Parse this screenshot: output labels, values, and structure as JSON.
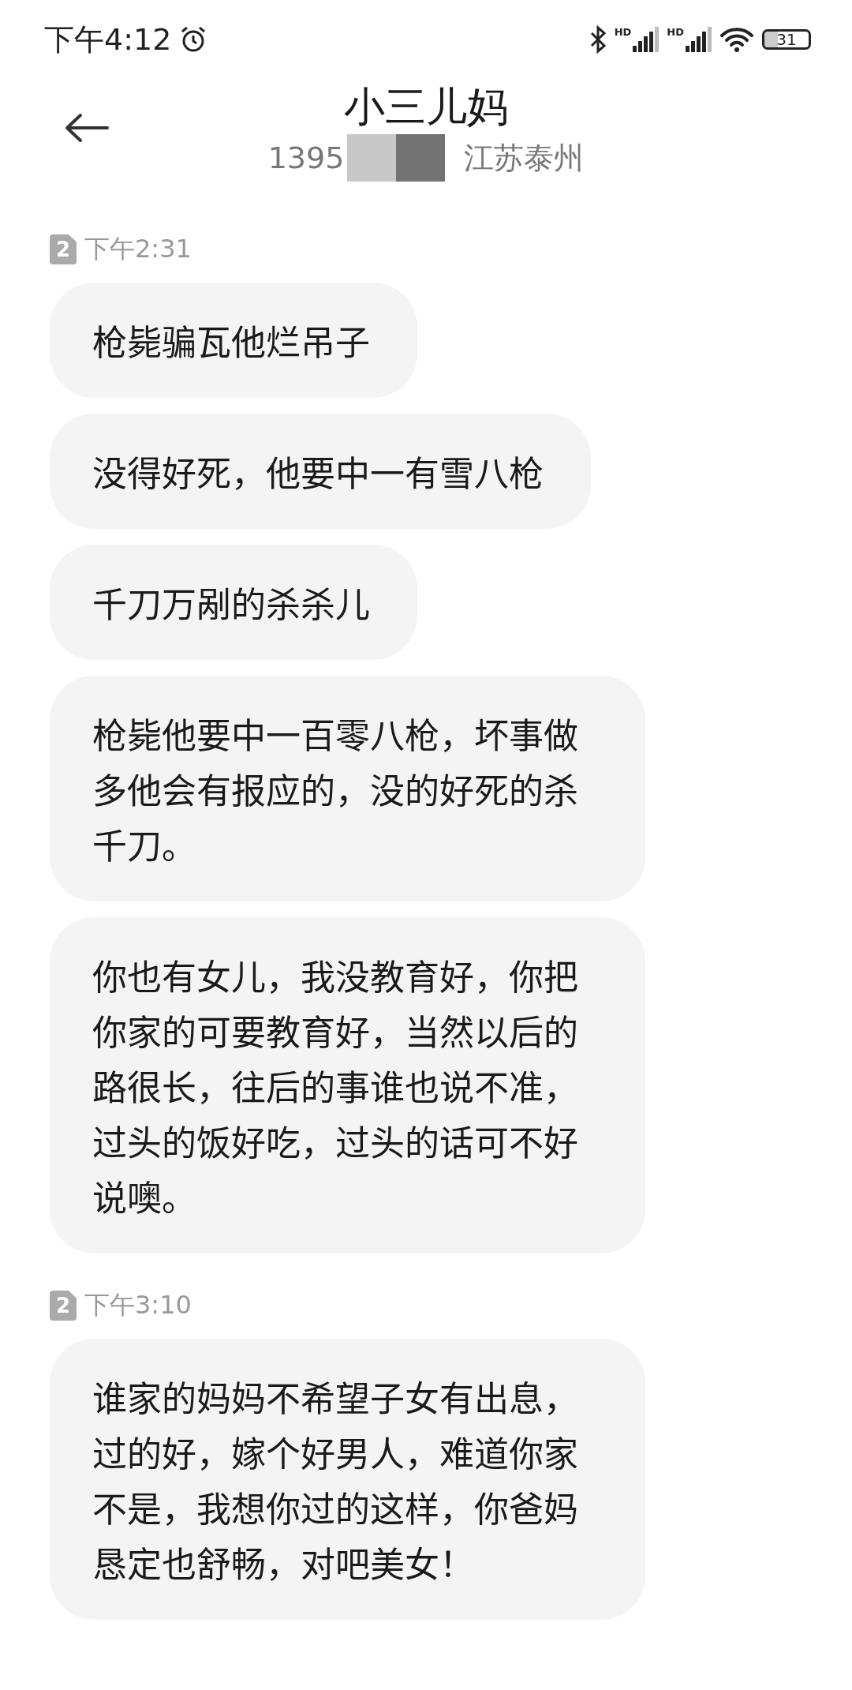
{
  "status_bar": {
    "time": "下午4:12",
    "signals": [
      {
        "label": "HD"
      },
      {
        "label": "HD"
      }
    ],
    "battery": "31"
  },
  "header": {
    "title": "小三儿妈",
    "number": "1395",
    "location": "江苏泰州"
  },
  "messages": [
    {
      "kind": "time",
      "sim": "2",
      "time": "下午2:31"
    },
    {
      "kind": "bubble",
      "text": "枪毙骗瓦他烂吊子"
    },
    {
      "kind": "bubble",
      "text": "没得好死，他要中一有雪八枪"
    },
    {
      "kind": "bubble",
      "text": "千刀万剐的杀杀儿"
    },
    {
      "kind": "bubble",
      "text": "枪毙他要中一百零八枪，坏事做多他会有报应的，没的好死的杀千刀。"
    },
    {
      "kind": "bubble",
      "text": "你也有女儿，我没教育好，你把你家的可要教育好，当然以后的路很长，往后的事谁也说不准，过头的饭好吃，过头的话可不好说噢。"
    },
    {
      "kind": "time",
      "sim": "2",
      "time": "下午3:10"
    },
    {
      "kind": "bubble",
      "text": "谁家的妈妈不希望子女有出息，过的好，嫁个好男人，难道你家不是，我想你过的这样，你爸妈恳定也舒畅，对吧美女！"
    }
  ]
}
